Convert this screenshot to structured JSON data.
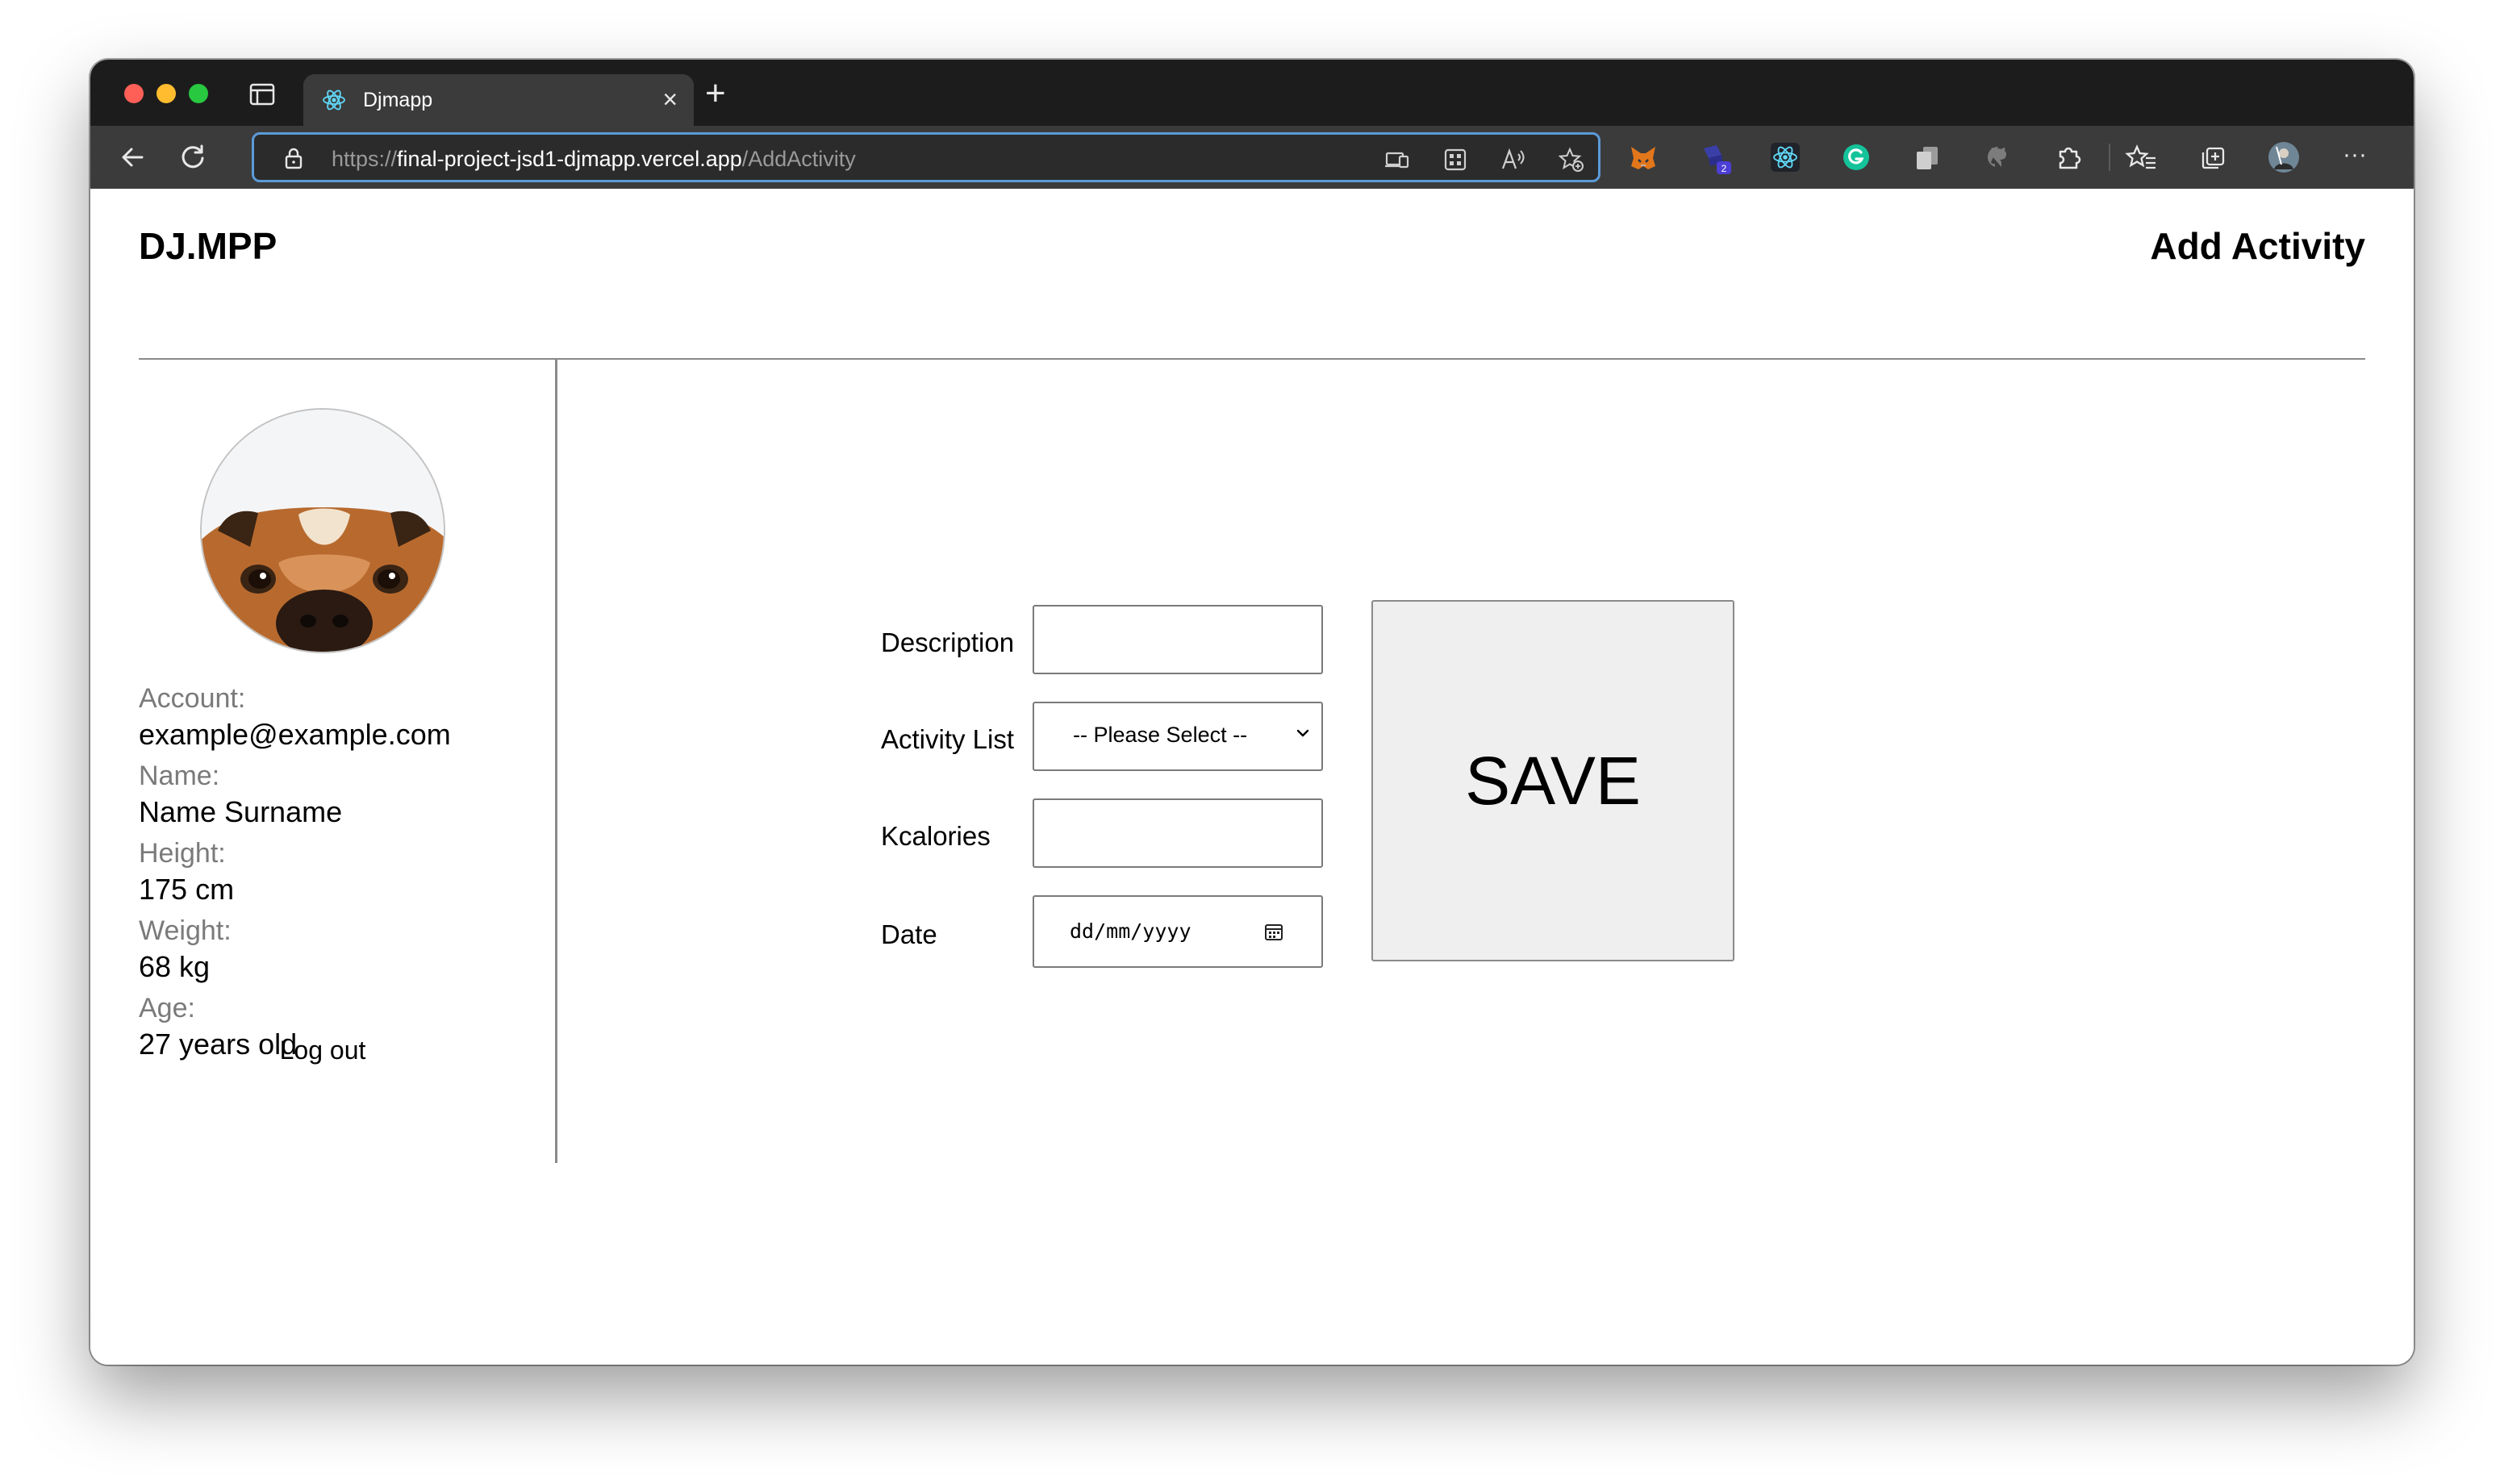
{
  "browser": {
    "tab_title": "Djmapp",
    "tab_close": "×",
    "new_tab": "+",
    "url_scheme": "https://",
    "url_host": "final-project-jsd1-djmapp.vercel.app",
    "url_path": "/AddActivity",
    "extension_badge": "2",
    "more_menu": "···",
    "icons": [
      "back-icon",
      "reload-icon",
      "lock-icon",
      "app-available-icon",
      "apps-icon",
      "read-aloud-icon",
      "add-favorite-icon",
      "metamask-icon",
      "extension-badge-icon",
      "react-devtools-icon",
      "grammarly-icon",
      "copy-icon",
      "github-icon",
      "extensions-icon",
      "favorites-icon",
      "collections-icon",
      "profile-avatar",
      "more-icon"
    ]
  },
  "header": {
    "brand": "DJ.MPP",
    "title": "Add Activity"
  },
  "profile": {
    "account_label": "Account:",
    "account_value": "example@example.com",
    "name_label": "Name:",
    "name_value": "Name Surname",
    "height_label": "Height:",
    "height_value": "175 cm",
    "weight_label": "Weight:",
    "weight_value": "68 kg",
    "age_label": "Age:",
    "age_value": "27 years old",
    "logout": "Log out"
  },
  "form": {
    "description_label": "Description",
    "description_value": "",
    "activity_label": "Activity List",
    "activity_selected": "-- Please Select --",
    "kcal_label": "Kcalories",
    "kcal_value": "",
    "date_label": "Date",
    "date_placeholder": "dd/mm/yyyy",
    "save": "SAVE"
  },
  "colors": {
    "address_focus": "#5b9bd8",
    "save_bg": "#efefef",
    "muted_label": "#7a7a7a"
  }
}
